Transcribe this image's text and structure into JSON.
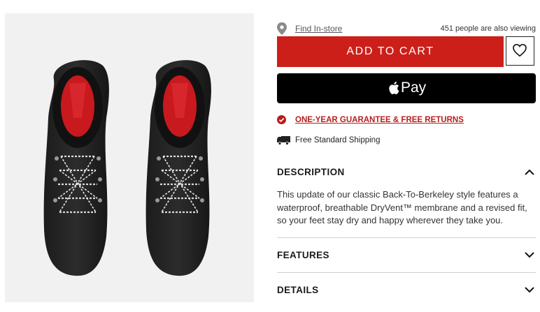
{
  "store": {
    "find_label": "Find In-store",
    "viewing_text": "451 people are also viewing"
  },
  "actions": {
    "add_to_cart_label": "ADD TO CART",
    "apple_pay_label": "Pay",
    "wishlist_icon": "heart-icon"
  },
  "perks": {
    "guarantee_label": "ONE-YEAR GUARANTEE & FREE RETURNS",
    "shipping_label": "Free Standard Shipping"
  },
  "sections": {
    "description": {
      "title": "DESCRIPTION",
      "body": "This update of our classic Back-To-Berkeley style features a waterproof, breathable DryVent™ membrane and a revised fit, so your feet stay dry and happy wherever they take you."
    },
    "features": {
      "title": "FEATURES"
    },
    "details": {
      "title": "DETAILS"
    }
  },
  "colors": {
    "brand_red": "#cc1f1a",
    "link_red": "#b91c1c",
    "apple_pay_bg": "#000000",
    "image_bg": "#f1f1f1"
  }
}
